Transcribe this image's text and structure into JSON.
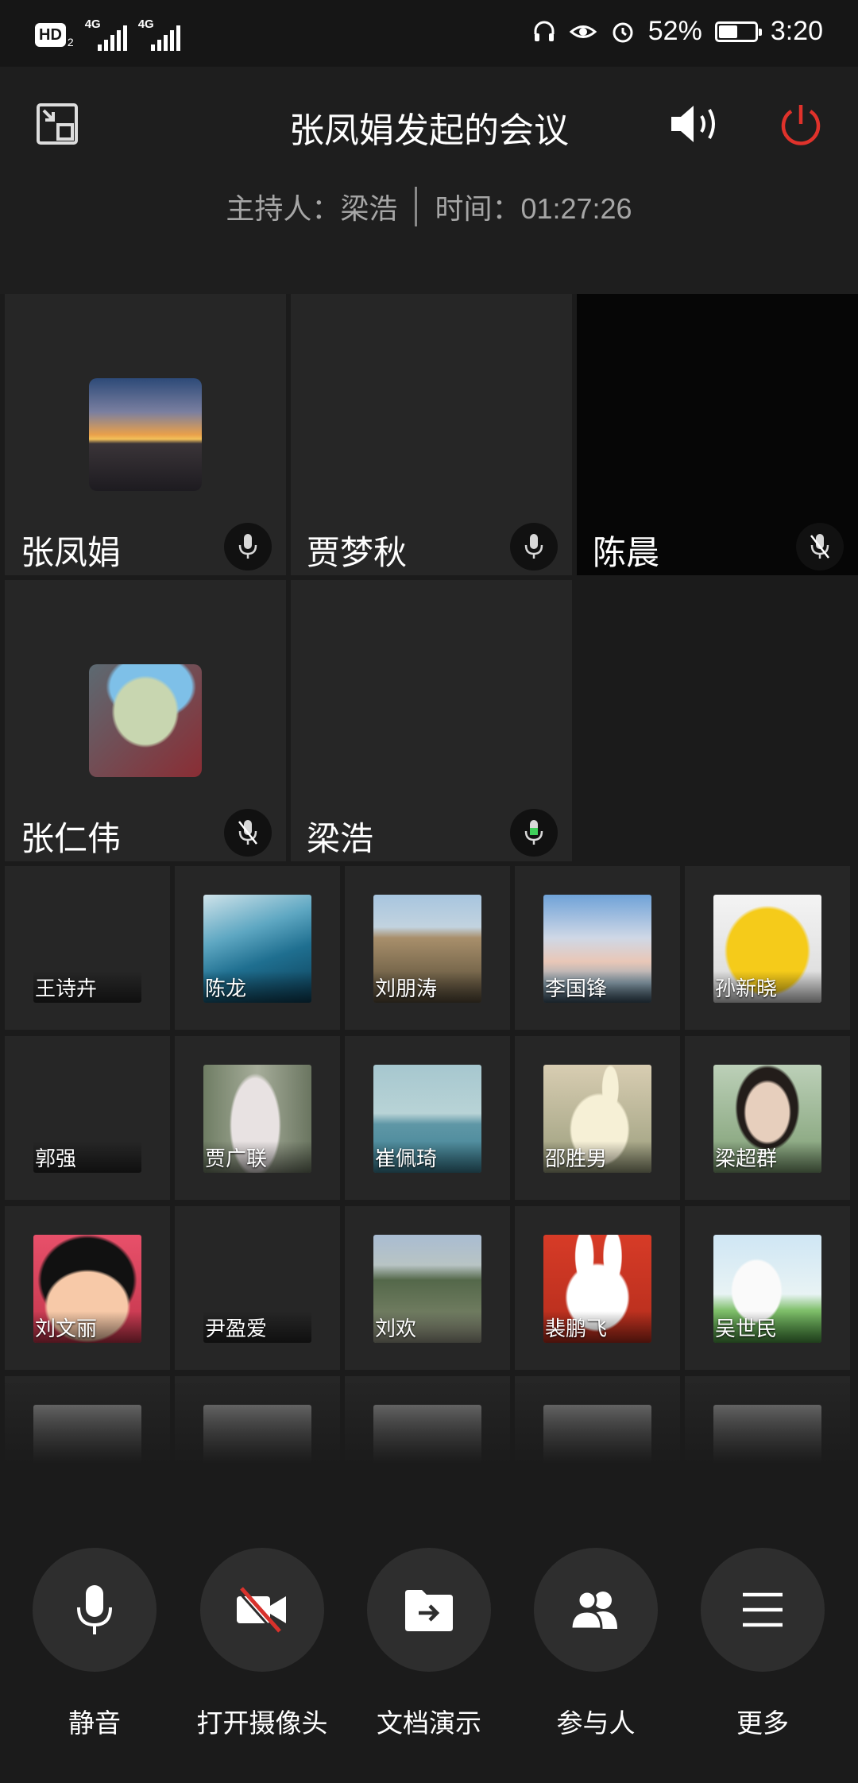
{
  "status_bar": {
    "hd_label": "HD",
    "hd_sub": "2",
    "sim1_label": "4G",
    "sim2_label": "4G",
    "battery_text": "52%",
    "battery_level": 0.52,
    "time": "3:20"
  },
  "header": {
    "title": "张凤娟发起的会议",
    "host_text": "主持人：梁浩",
    "time_text": "时间：01:27:26",
    "colors": {
      "end_call": "#e0322b"
    }
  },
  "video_tiles": [
    {
      "name": "张凤娟",
      "avatar_icon": "sunset-lake-photo",
      "mic_state": "on"
    },
    {
      "name": "贾梦秋",
      "avatar_icon": "person-in-chair-photo",
      "mic_state": "on"
    },
    {
      "name": "陈晨",
      "avatar_icon": "",
      "mic_state": "muted"
    },
    {
      "name": "张仁伟",
      "avatar_icon": "cartoon-scientist-photo",
      "mic_state": "muted"
    },
    {
      "name": "梁浩",
      "avatar_icon": "snow-mountain-photo",
      "mic_state": "speaking"
    }
  ],
  "participants": [
    {
      "name": "王诗卉",
      "avatar_icon": "spiral-glasses-photo"
    },
    {
      "name": "陈龙",
      "avatar_icon": "ocean-wave-photo"
    },
    {
      "name": "刘朋涛",
      "avatar_icon": "building-photo"
    },
    {
      "name": "李国锋",
      "avatar_icon": "sky-clouds-photo"
    },
    {
      "name": "孙新晓",
      "avatar_icon": "yellow-candy-mascot-photo"
    },
    {
      "name": "郭强",
      "avatar_icon": "man-standing-photo"
    },
    {
      "name": "贾广联",
      "avatar_icon": "tree-trunk-photo"
    },
    {
      "name": "崔佩琦",
      "avatar_icon": "sea-horizon-photo"
    },
    {
      "name": "邵胜男",
      "avatar_icon": "bunny-toy-photo"
    },
    {
      "name": "梁超群",
      "avatar_icon": "woman-portrait-photo"
    },
    {
      "name": "刘文丽",
      "avatar_icon": "cartoon-girl-photo"
    },
    {
      "name": "尹盈爱",
      "avatar_icon": "sleeping-bunny-photo"
    },
    {
      "name": "刘欢",
      "avatar_icon": "village-photo"
    },
    {
      "name": "裴鹏飞",
      "avatar_icon": "bunny-soldier-photo"
    },
    {
      "name": "吴世民",
      "avatar_icon": "tennis-cartoon-photo"
    },
    {
      "name": "",
      "avatar_icon": "faded-photo"
    },
    {
      "name": "",
      "avatar_icon": "faded-photo"
    },
    {
      "name": "",
      "avatar_icon": "faded-photo"
    },
    {
      "name": "",
      "avatar_icon": "faded-photo"
    },
    {
      "name": "",
      "avatar_icon": "faded-photo"
    }
  ],
  "toolbar": {
    "mute_label": "静音",
    "camera_label": "打开摄像头",
    "present_label": "文档演示",
    "participants_label": "参与人",
    "more_label": "更多"
  }
}
